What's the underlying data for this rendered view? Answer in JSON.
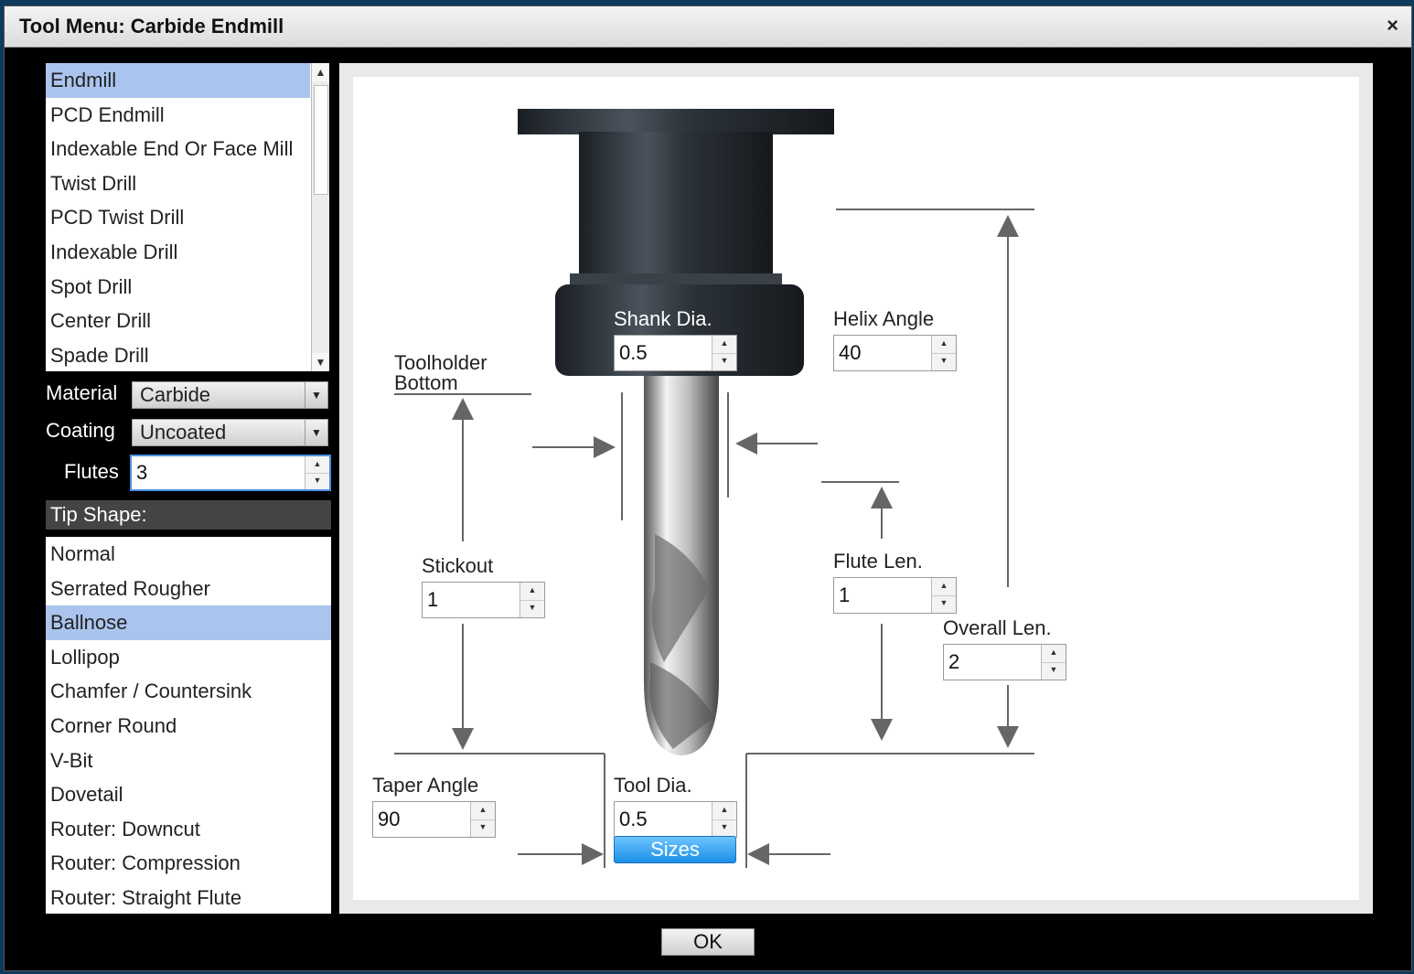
{
  "dialog": {
    "title": "Tool Menu: Carbide Endmill",
    "close_label": "×"
  },
  "tool_types": {
    "items": [
      "Endmill",
      "PCD Endmill",
      "Indexable End Or Face Mill",
      "Twist Drill",
      "PCD Twist Drill",
      "Indexable Drill",
      "Spot Drill",
      "Center Drill",
      "Spade Drill"
    ],
    "selected": "Endmill"
  },
  "material": {
    "label": "Material",
    "value": "Carbide"
  },
  "coating": {
    "label": "Coating",
    "value": "Uncoated"
  },
  "flutes": {
    "label": "Flutes",
    "value": "3"
  },
  "tip_shape": {
    "header": "Tip Shape:",
    "items": [
      "Normal",
      "Serrated Rougher",
      "Ballnose",
      "Lollipop",
      "Chamfer / Countersink",
      "Corner Round",
      "V-Bit",
      "Dovetail",
      "Router: Downcut",
      "Router: Compression",
      "Router: Straight Flute"
    ],
    "selected": "Ballnose"
  },
  "diagram": {
    "shank_dia": {
      "label": "Shank Dia.",
      "value": "0.5"
    },
    "helix_angle": {
      "label": "Helix Angle",
      "value": "40"
    },
    "toolholder_bottom": {
      "line1": "Toolholder",
      "line2": "Bottom"
    },
    "stickout": {
      "label": "Stickout",
      "value": "1"
    },
    "flute_len": {
      "label": "Flute Len.",
      "value": "1"
    },
    "overall_len": {
      "label": "Overall Len.",
      "value": "2"
    },
    "taper_angle": {
      "label": "Taper Angle",
      "value": "90"
    },
    "tool_dia": {
      "label": "Tool Dia.",
      "value": "0.5"
    },
    "sizes_label": "Sizes"
  },
  "ok_label": "OK",
  "colors": {
    "selection": "#aac4ee",
    "sizes_button": "#1b8ee8",
    "background": "#000000"
  }
}
